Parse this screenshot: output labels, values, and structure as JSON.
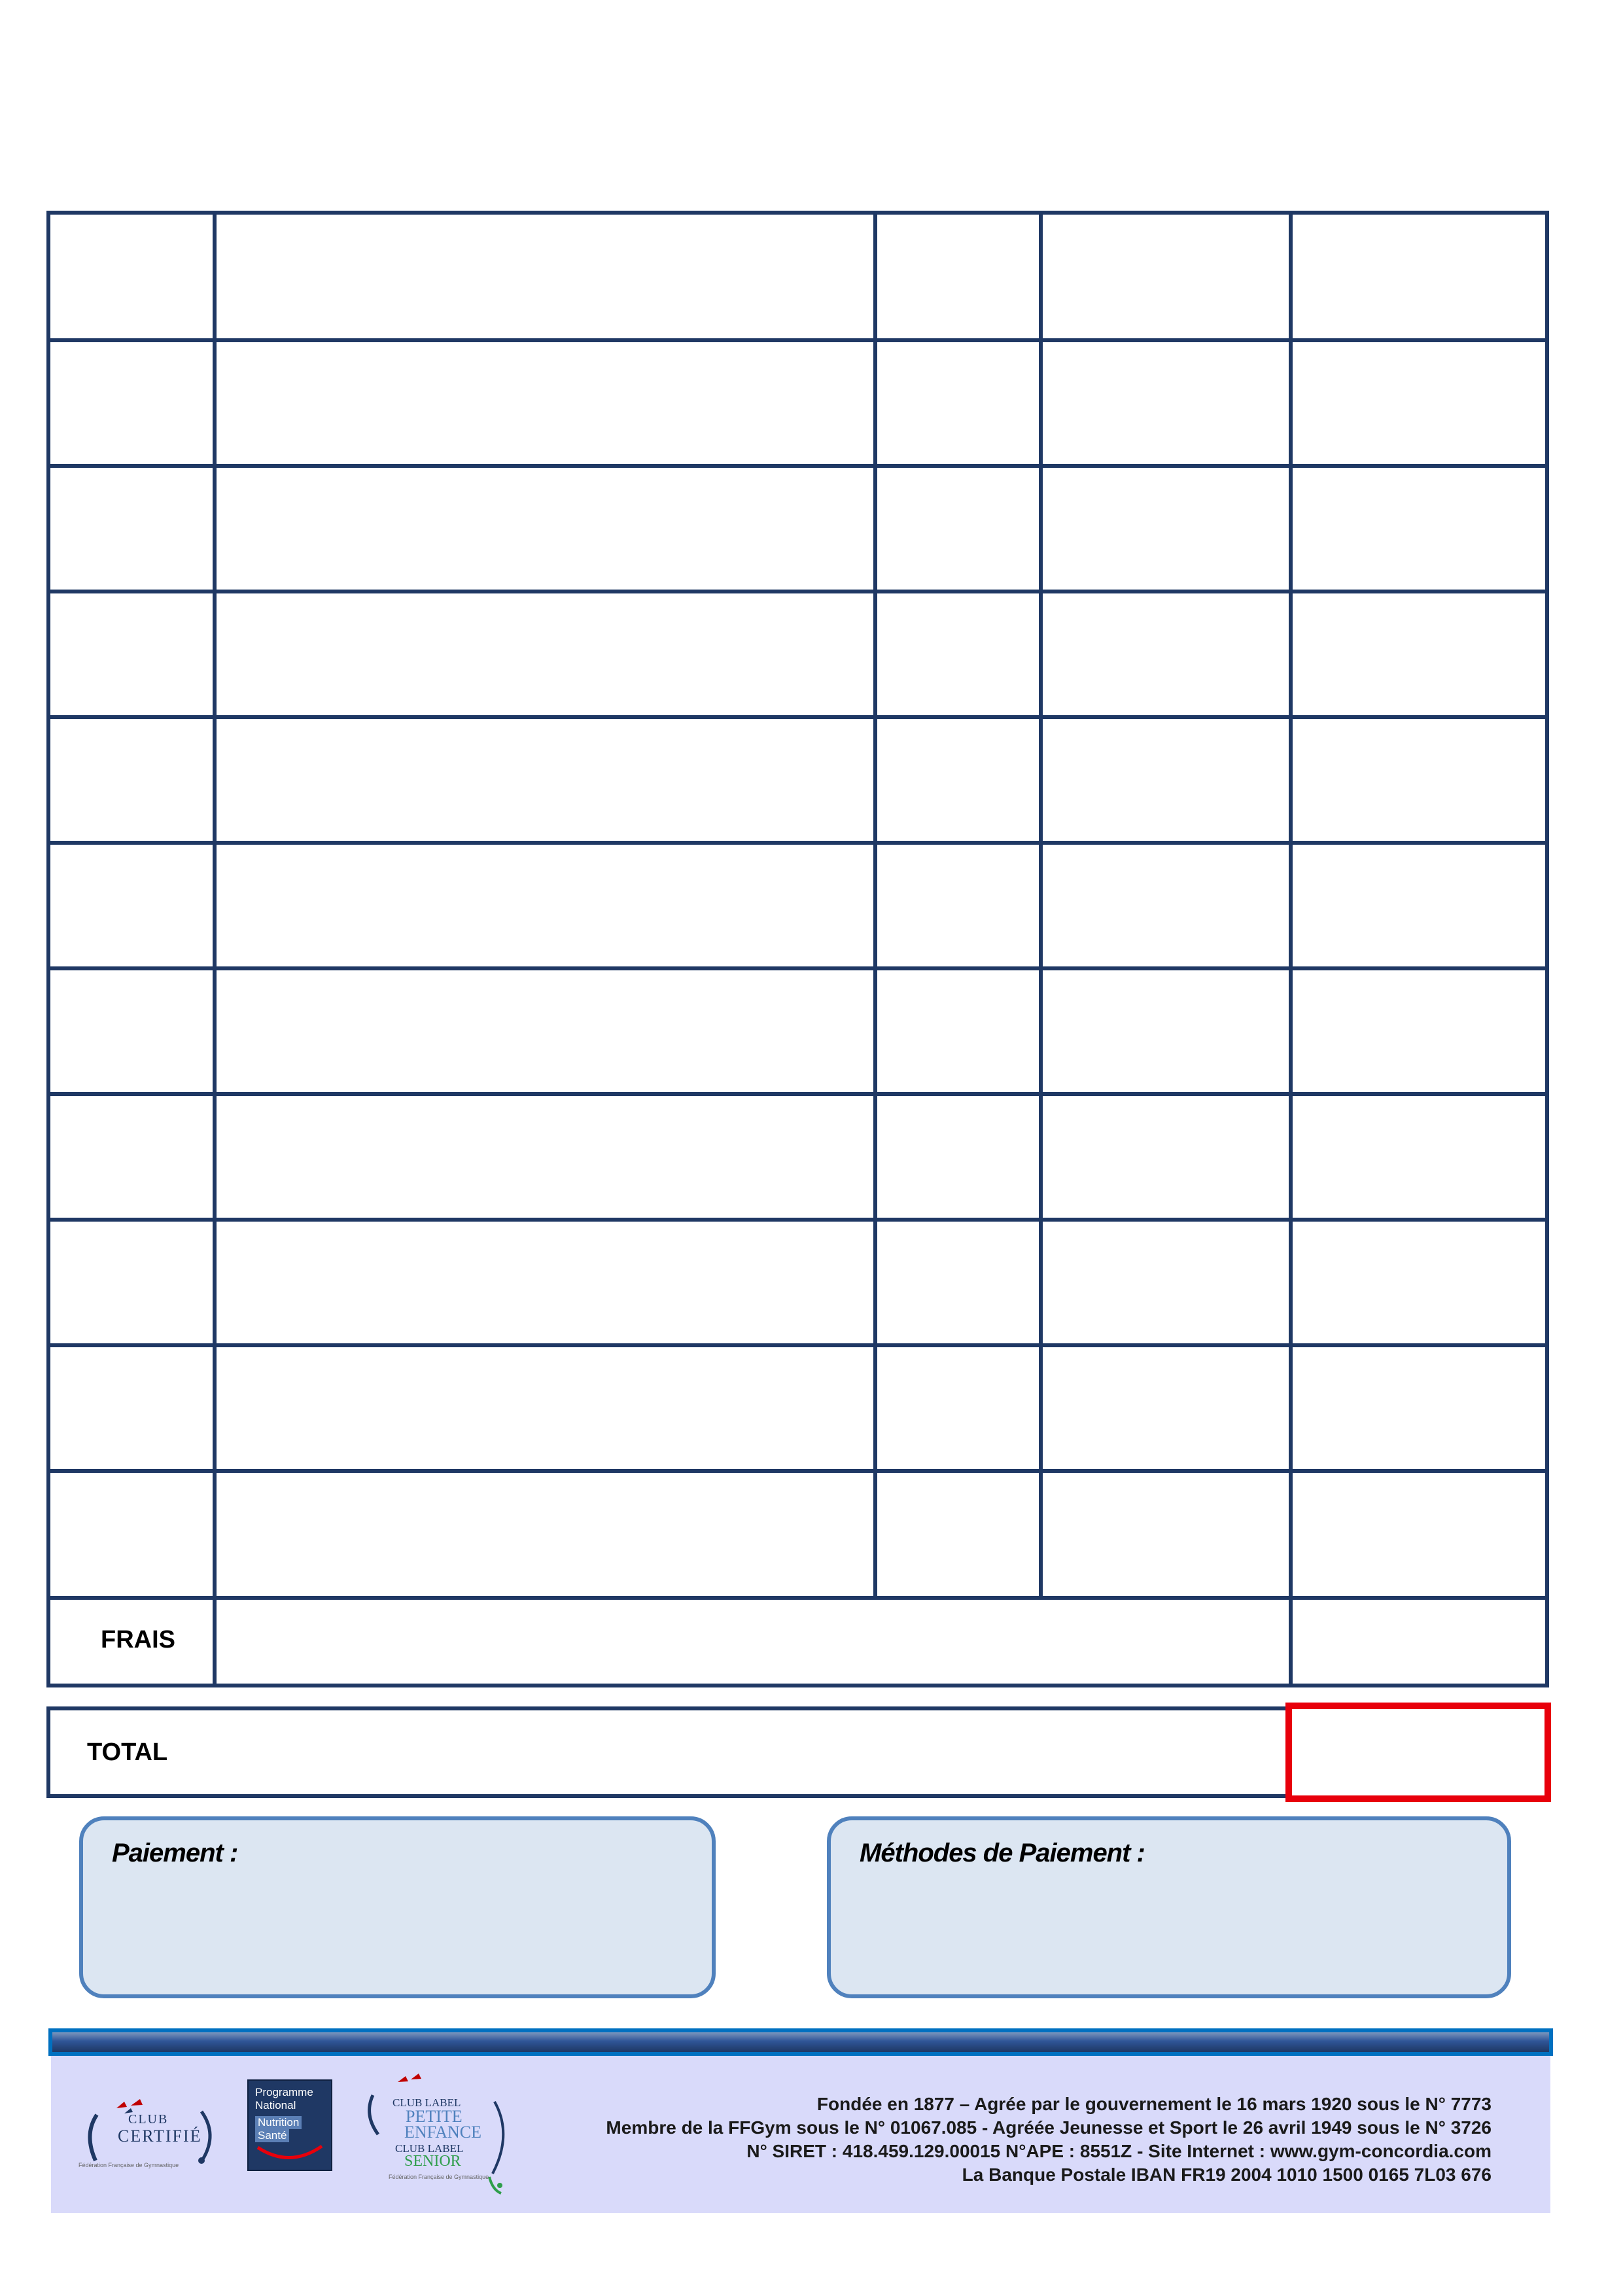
{
  "invoice": {
    "rows": [
      {
        "c1": "",
        "c2": "",
        "c3": "",
        "c4": "",
        "c5": ""
      },
      {
        "c1": "",
        "c2": "",
        "c3": "",
        "c4": "",
        "c5": ""
      },
      {
        "c1": "",
        "c2": "",
        "c3": "",
        "c4": "",
        "c5": ""
      },
      {
        "c1": "",
        "c2": "",
        "c3": "",
        "c4": "",
        "c5": ""
      },
      {
        "c1": "",
        "c2": "",
        "c3": "",
        "c4": "",
        "c5": ""
      },
      {
        "c1": "",
        "c2": "",
        "c3": "",
        "c4": "",
        "c5": ""
      },
      {
        "c1": "",
        "c2": "",
        "c3": "",
        "c4": "",
        "c5": ""
      },
      {
        "c1": "",
        "c2": "",
        "c3": "",
        "c4": "",
        "c5": ""
      },
      {
        "c1": "",
        "c2": "",
        "c3": "",
        "c4": "",
        "c5": ""
      },
      {
        "c1": "",
        "c2": "",
        "c3": "",
        "c4": "",
        "c5": ""
      },
      {
        "c1": "",
        "c2": "",
        "c3": "",
        "c4": "",
        "c5": ""
      }
    ],
    "frais_label": "FRAIS",
    "frais_value": "",
    "total_label": "TOTAL",
    "total_value": ""
  },
  "payment": {
    "title": "Paiement :",
    "value": ""
  },
  "payment_methods": {
    "title": "Méthodes de Paiement :",
    "value": ""
  },
  "footer": {
    "logos": {
      "club_certifie": {
        "line1": "CLUB",
        "line2": "CERTIFIÉ",
        "caption": "Fédération Française de Gymnastique",
        "icon": "club-certifie-logo"
      },
      "pns": {
        "line1": "Programme",
        "line2": "National",
        "line3": "Nutrition",
        "line4": "Santé",
        "icon": "pnns-logo"
      },
      "club_label": {
        "line1": "CLUB LABEL",
        "line2": "PETITE",
        "line3": "ENFANCE",
        "line4": "CLUB LABEL",
        "line5": "SENIOR",
        "caption": "Fédération Française de Gymnastique",
        "icon": "club-label-logo"
      }
    },
    "lines": [
      "Fondée en 1877 – Agrée par le gouvernement le 16 mars 1920 sous le N° 7773",
      "Membre de la FFGym  sous le N° 01067.085 - Agréée Jeunesse et Sport le 26 avril 1949 sous le N° 3726",
      "N° SIRET : 418.459.129.00015    N°APE : 8551Z  -  Site Internet : www.gym-concordia.com",
      "La Banque Postale IBAN FR19 2004 1010 1500 0165 7L03 676"
    ]
  },
  "colors": {
    "table_border": "#1f3864",
    "total_highlight": "#e8000b",
    "payment_box_fill": "#dce6f2",
    "payment_box_border": "#4f81bd",
    "footer_panel": "#d9dafa"
  }
}
